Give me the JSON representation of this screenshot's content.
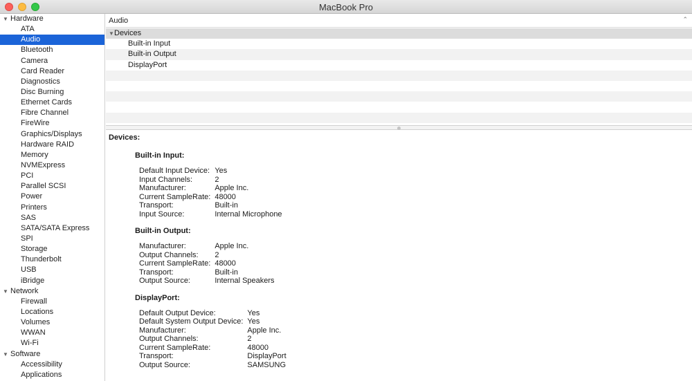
{
  "window": {
    "title": "MacBook Pro"
  },
  "sidebar": {
    "groups": [
      {
        "label": "Hardware",
        "items": [
          "ATA",
          "Audio",
          "Bluetooth",
          "Camera",
          "Card Reader",
          "Diagnostics",
          "Disc Burning",
          "Ethernet Cards",
          "Fibre Channel",
          "FireWire",
          "Graphics/Displays",
          "Hardware RAID",
          "Memory",
          "NVMExpress",
          "PCI",
          "Parallel SCSI",
          "Power",
          "Printers",
          "SAS",
          "SATA/SATA Express",
          "SPI",
          "Storage",
          "Thunderbolt",
          "USB",
          "iBridge"
        ]
      },
      {
        "label": "Network",
        "items": [
          "Firewall",
          "Locations",
          "Volumes",
          "WWAN",
          "Wi-Fi"
        ]
      },
      {
        "label": "Software",
        "items": [
          "Accessibility",
          "Applications"
        ]
      }
    ],
    "selected": "Audio"
  },
  "column_header": {
    "label": "Audio"
  },
  "tree": {
    "root": "Devices",
    "children": [
      "Built-in Input",
      "Built-in Output",
      "DisplayPort"
    ]
  },
  "detail": {
    "heading": "Devices:",
    "sections": [
      {
        "title": "Built-in Input:",
        "rows": [
          [
            "Default Input Device:",
            "Yes"
          ],
          [
            "Input Channels:",
            "2"
          ],
          [
            "Manufacturer:",
            "Apple Inc."
          ],
          [
            "Current SampleRate:",
            "48000"
          ],
          [
            "Transport:",
            "Built-in"
          ],
          [
            "Input Source:",
            "Internal Microphone"
          ]
        ]
      },
      {
        "title": "Built-in Output:",
        "rows": [
          [
            "Manufacturer:",
            "Apple Inc."
          ],
          [
            "Output Channels:",
            "2"
          ],
          [
            "Current SampleRate:",
            "48000"
          ],
          [
            "Transport:",
            "Built-in"
          ],
          [
            "Output Source:",
            "Internal Speakers"
          ]
        ]
      },
      {
        "title": "DisplayPort:",
        "rows": [
          [
            "Default Output Device:",
            "Yes"
          ],
          [
            "Default System Output Device:",
            "Yes"
          ],
          [
            "Manufacturer:",
            "Apple Inc."
          ],
          [
            "Output Channels:",
            "2"
          ],
          [
            "Current SampleRate:",
            "48000"
          ],
          [
            "Transport:",
            "DisplayPort"
          ],
          [
            "Output Source:",
            "SAMSUNG"
          ]
        ]
      }
    ]
  }
}
